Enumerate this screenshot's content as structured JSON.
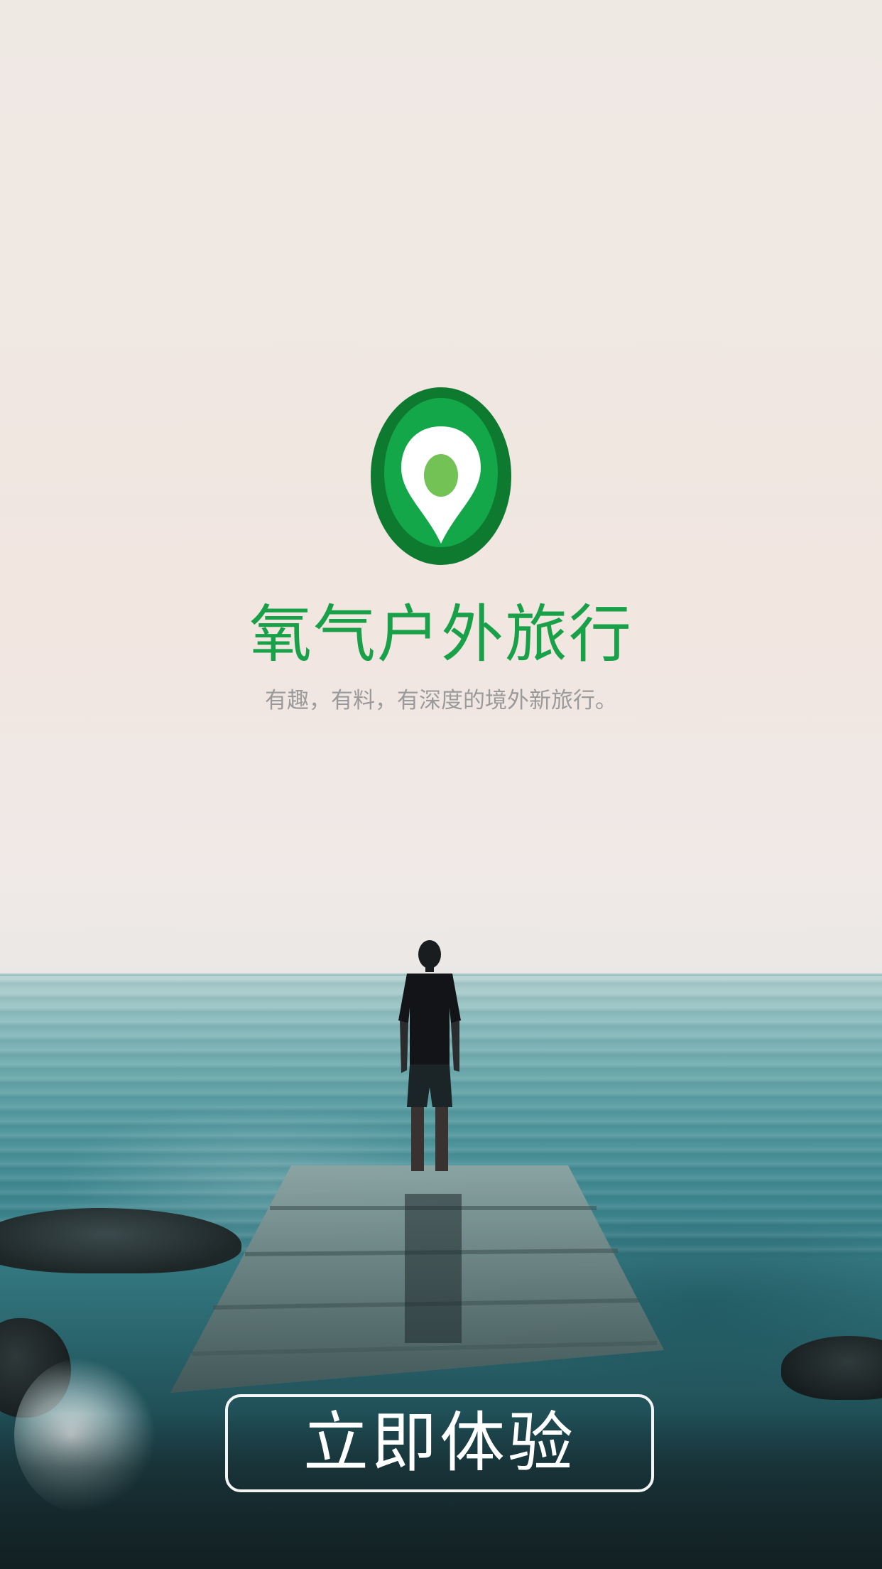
{
  "app": {
    "title": "氧气户外旅行",
    "tagline": "有趣，有料，有深度的境外新旅行。"
  },
  "cta": {
    "label": "立即体验"
  },
  "logo": {
    "icon": "map-pin-icon",
    "colors": {
      "outer": "#0e7a30",
      "middle": "#14a74a",
      "inner": "#ffffff",
      "dot": "#72c255"
    }
  },
  "theme": {
    "accent": "#19a14a",
    "tagline_color": "#9a9a9a",
    "button_border": "#ffffff"
  }
}
